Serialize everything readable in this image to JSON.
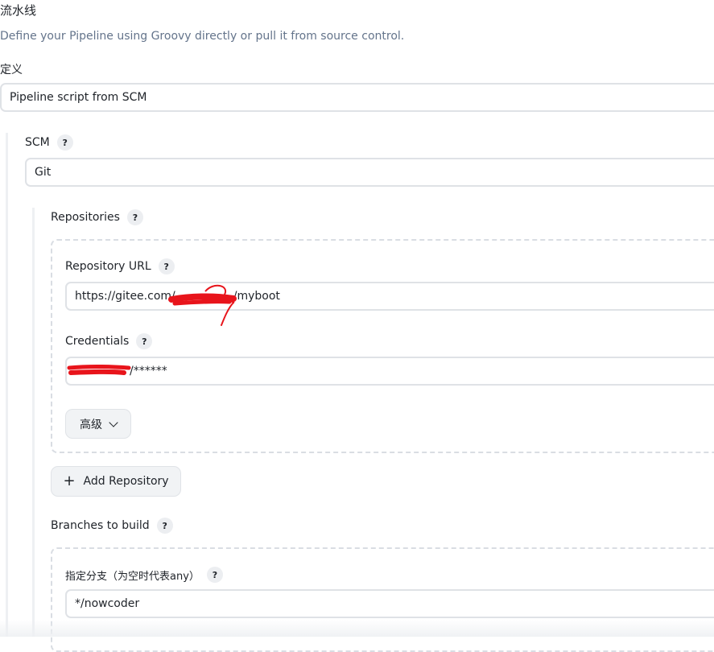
{
  "section": {
    "title": "流水线",
    "description": "Define your Pipeline using Groovy directly or pull it from source control."
  },
  "definition": {
    "label": "定义",
    "selected": "Pipeline script from SCM"
  },
  "scm": {
    "label": "SCM",
    "selected": "Git"
  },
  "repositories": {
    "label": "Repositories",
    "url_label": "Repository URL",
    "url_prefix": "https://gitee.com/",
    "url_suffix": "/myboot",
    "credentials_label": "Credentials",
    "credentials_value": "/******",
    "advanced_label": "高级",
    "add_label": "Add Repository"
  },
  "branches": {
    "label": "Branches to build",
    "specifier_label": "指定分支（为空时代表any）",
    "specifier_value": "*/nowcoder"
  },
  "help_glyph": "?",
  "icons": {
    "help": "question-mark-icon",
    "advanced": "chevron-down-icon",
    "add": "plus-icon"
  },
  "colors": {
    "border": "#dfe2e6",
    "help_bg": "#eceef1",
    "description": "#64748b",
    "redaction": "#e8141b"
  }
}
